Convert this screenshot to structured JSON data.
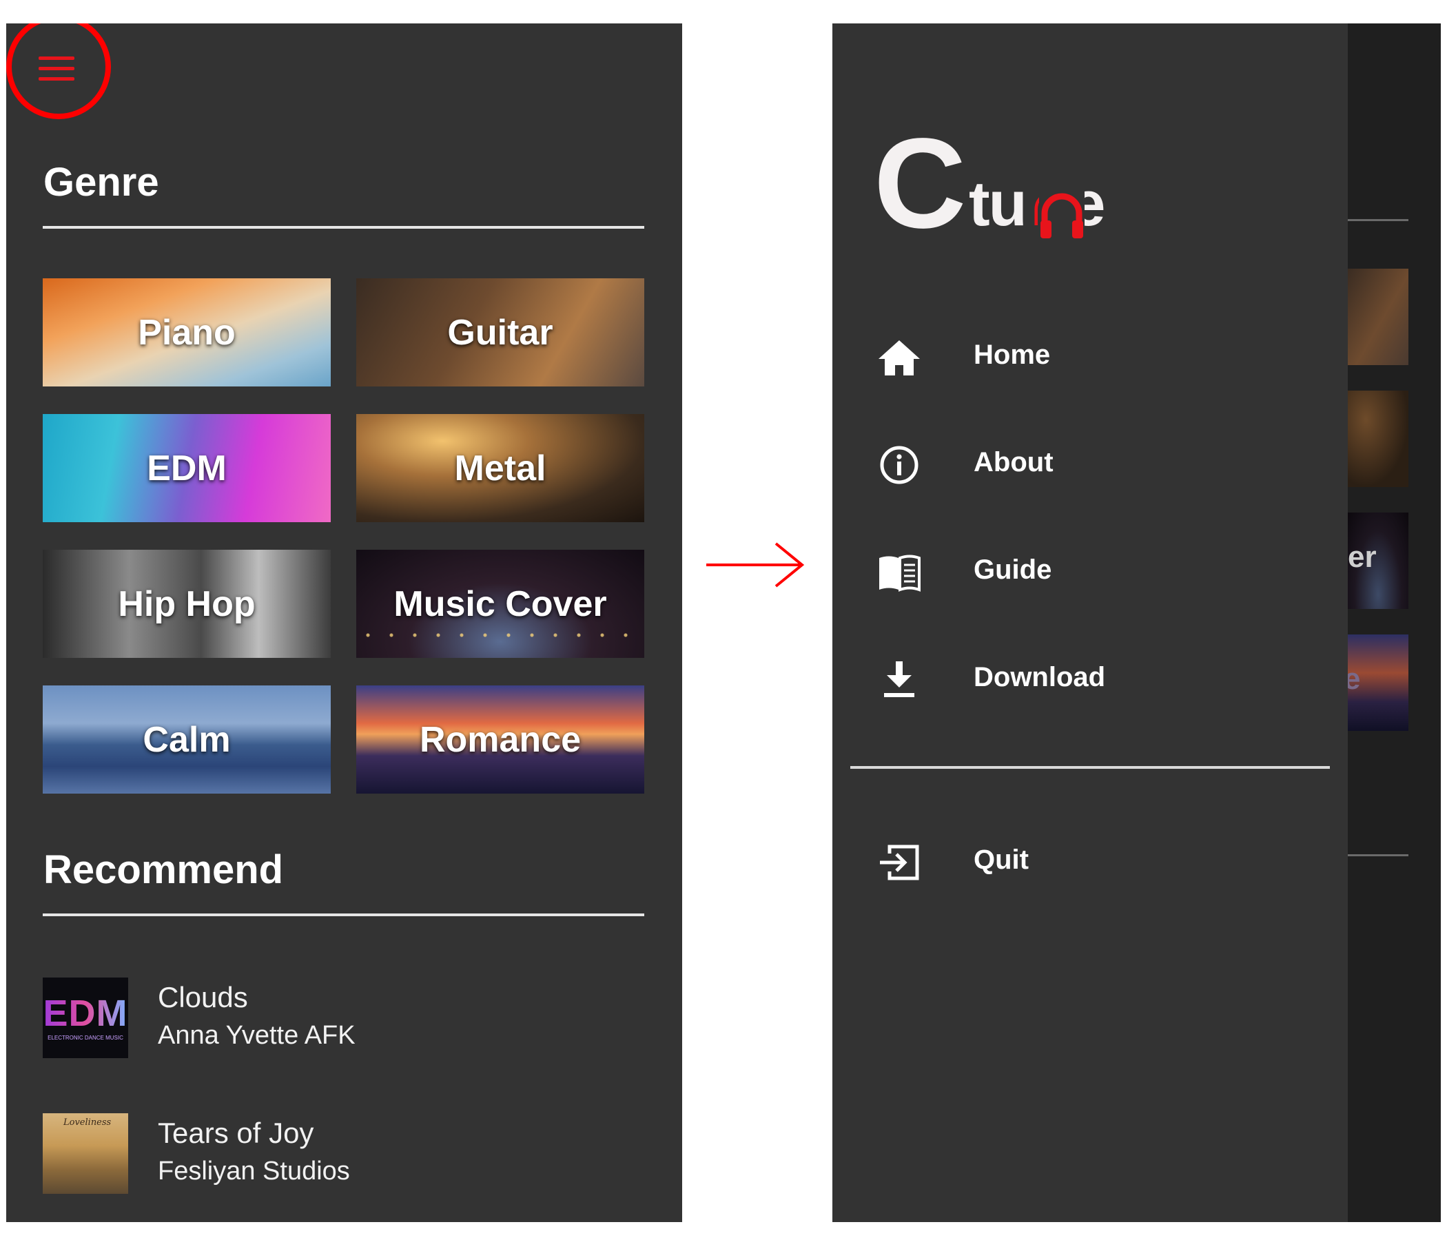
{
  "left_screen": {
    "genre": {
      "title": "Genre",
      "tiles": [
        {
          "label": "Piano"
        },
        {
          "label": "Guitar"
        },
        {
          "label": "EDM"
        },
        {
          "label": "Metal"
        },
        {
          "label": "Hip Hop"
        },
        {
          "label": "Music Cover"
        },
        {
          "label": "Calm"
        },
        {
          "label": "Romance"
        }
      ]
    },
    "recommend": {
      "title": "Recommend",
      "songs": [
        {
          "title": "Clouds",
          "artist": "Anna Yvette AFK",
          "thumb_text": "EDM",
          "thumb_subtext": "ELECTRONIC DANCE MUSIC"
        },
        {
          "title": "Tears of Joy",
          "artist": "Fesliyan Studios",
          "thumb_text": "Loveliness"
        }
      ]
    }
  },
  "drawer": {
    "logo": {
      "c": "C",
      "tune": "tu∩e"
    },
    "items": [
      {
        "label": "Home",
        "icon": "home-icon"
      },
      {
        "label": "About",
        "icon": "info-icon"
      },
      {
        "label": "Guide",
        "icon": "book-icon"
      },
      {
        "label": "Download",
        "icon": "download-icon"
      }
    ],
    "quit": {
      "label": "Quit",
      "icon": "exit-icon"
    },
    "backdrop_partial_texts": [
      "er",
      "e"
    ]
  },
  "colors": {
    "screen_bg": "#333333",
    "accent_red": "#e8141b",
    "highlight_red": "#ff0000",
    "text": "#ffffff"
  }
}
